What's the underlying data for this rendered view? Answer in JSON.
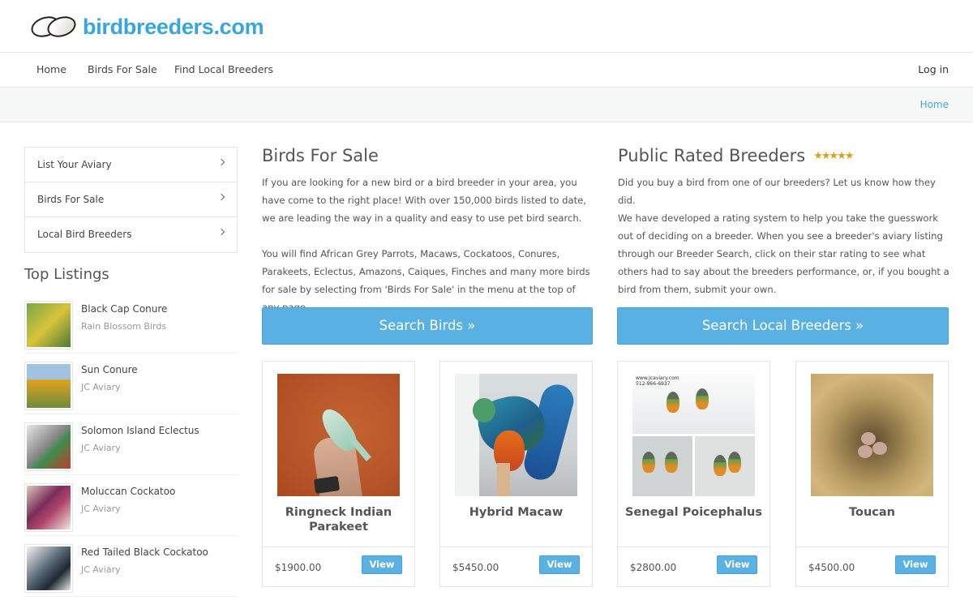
{
  "site": {
    "logo_text": "birdbreeders.com"
  },
  "nav": {
    "items": [
      "Home",
      "Birds For Sale",
      "Find Local Breeders"
    ],
    "login": "Log in"
  },
  "breadcrumb": "Home",
  "sidebar": {
    "menu": [
      "List Your Aviary",
      "Birds For Sale",
      "Local Bird Breeders"
    ],
    "top_title": "Top Listings",
    "top_listings": [
      {
        "name": "Black Cap Conure",
        "seller": "Rain Blossom Birds",
        "color": "#7aa84a"
      },
      {
        "name": "Sun Conure",
        "seller": "JC Aviary",
        "color": "#e0a21f"
      },
      {
        "name": "Solomon Island Eclectus",
        "seller": "JC Aviary",
        "color": "#3e8d4a"
      },
      {
        "name": "Moluccan Cockatoo",
        "seller": "JC Aviary",
        "color": "#b0446a"
      },
      {
        "name": "Red Tailed Black Cockatoo",
        "seller": "JC Aviary",
        "color": "#5a6a78"
      }
    ]
  },
  "birds_section": {
    "title": "Birds For Sale",
    "para1": "If you are looking for a new bird or a bird breeder in your area, you have come to the right place! With over 150,000 birds listed to date, we are leading the way in a quality and easy to use pet bird search.",
    "para2": "You will find African Grey Parrots, Macaws, Cockatoos, Conures, Parakeets, Eclectus, Amazons, Caiques, Finches and many more birds for sale by selecting from 'Birds For Sale' in the menu at the top of any page.",
    "button": "Search Birds »"
  },
  "breeders_section": {
    "title": "Public Rated Breeders",
    "stars": "★★★★★",
    "para1": "Did you buy a bird from one of our breeders? Let us know how they did.",
    "para2": "We have developed a rating system to help you take the guesswork out of deciding on a breeder. When you see a breeder's aviary listing through our Breeder Search, click on their star rating to see what others had to say about the breeders performance, or, if you bought a bird from them, submit your own.",
    "button": "Search Local Breeders »"
  },
  "cards": [
    {
      "title": "Ringneck Indian Parakeet",
      "price": "$1900.00",
      "button": "View"
    },
    {
      "title": "Hybrid Macaw",
      "price": "$5450.00",
      "button": "View"
    },
    {
      "title": "Senegal Poicephalus",
      "price": "$2800.00",
      "button": "View",
      "image_text": "www.Jcaviary.com\n512-966-6937"
    },
    {
      "title": "Toucan",
      "price": "$4500.00",
      "button": "View"
    }
  ]
}
